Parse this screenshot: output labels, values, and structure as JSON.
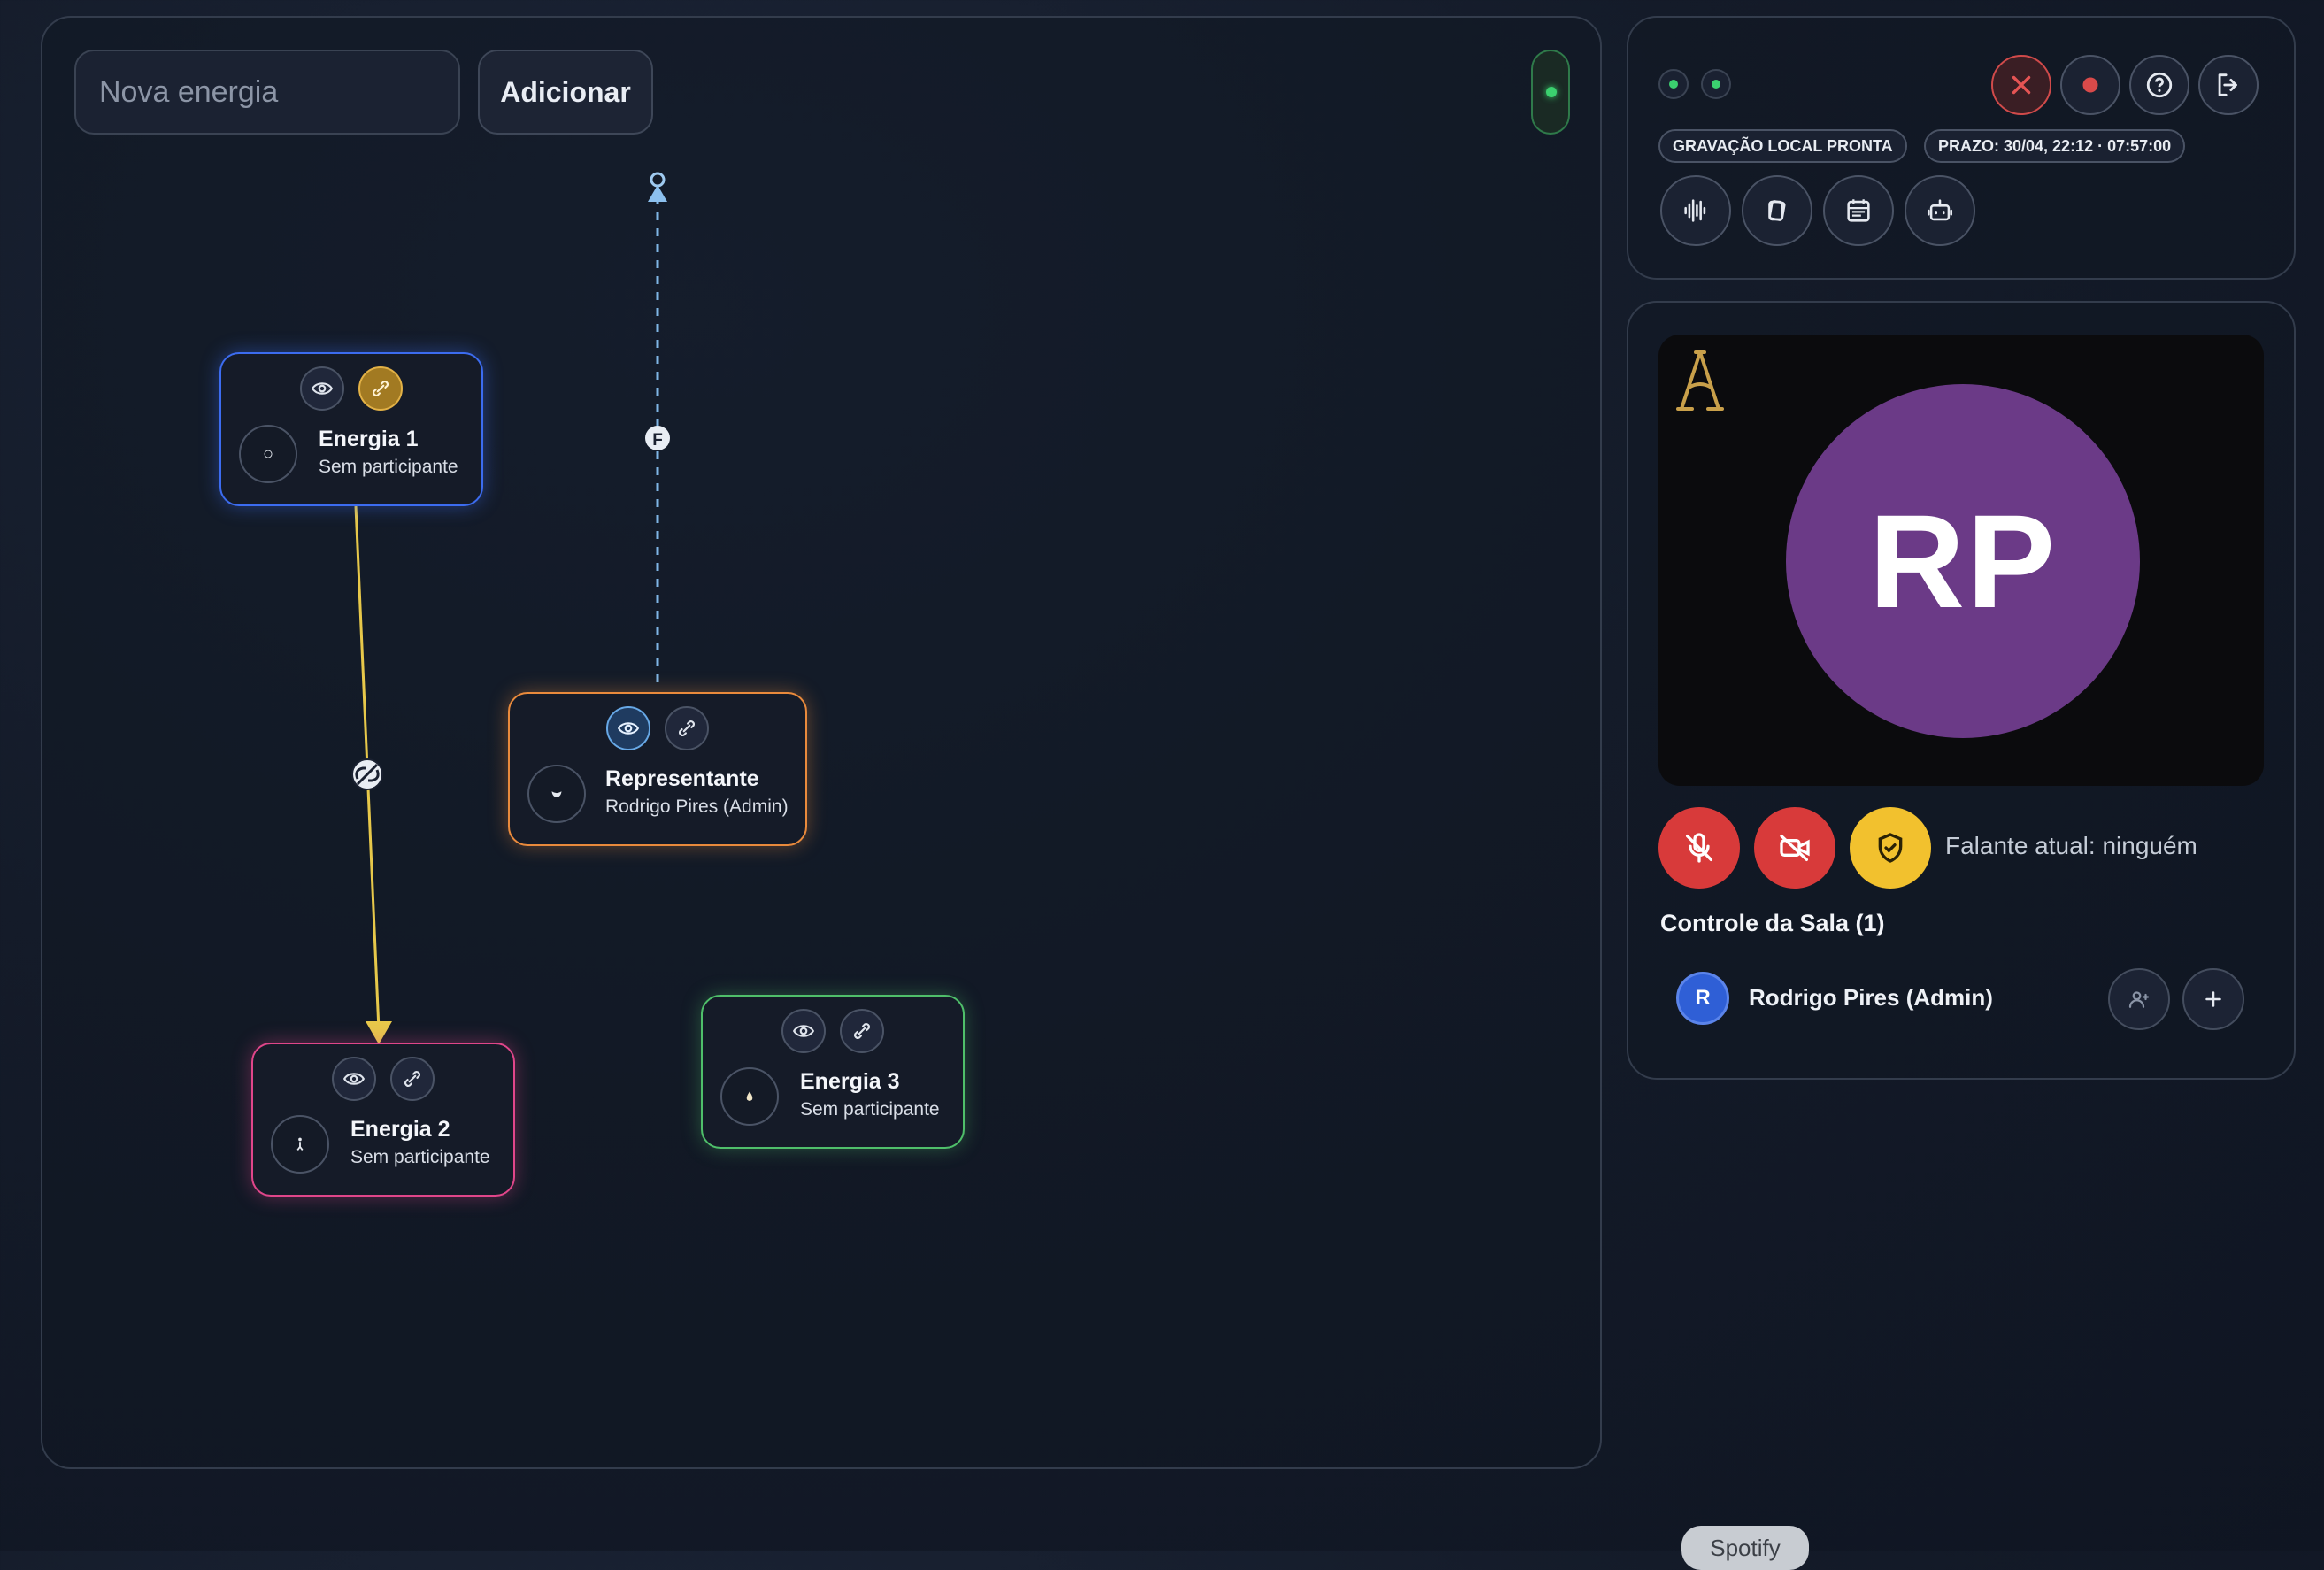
{
  "toolbar": {
    "input_value": "",
    "input_placeholder": "Nova energia",
    "add_label": "Adicionar"
  },
  "nodes": {
    "energia1": {
      "title": "Energia 1",
      "subtitle": "Sem participante",
      "icon": "circle-icon",
      "color": "#3c6cf0"
    },
    "representante": {
      "title": "Representante",
      "subtitle": "Rodrigo Pires (Admin)",
      "icon": "mask-icon",
      "color": "#e98a3c"
    },
    "energia2": {
      "title": "Energia 2",
      "subtitle": "Sem participante",
      "icon": "figure-icon",
      "color": "#e0468a"
    },
    "energia3": {
      "title": "Energia 3",
      "subtitle": "Sem participante",
      "icon": "drop-icon",
      "color": "#4fbf6a"
    }
  },
  "edges": {
    "flow_marker": "F",
    "link_color": "#e7c84a",
    "dashed_color": "#7fb6e6"
  },
  "status": {
    "recording_badge": "GRAVAÇÃO LOCAL PRONTA",
    "deadline_badge": "PRAZO: 30/04, 22:12 · 07:57:00"
  },
  "call": {
    "avatar_initials": "RP",
    "avatar_color": "#6b3a87",
    "speaker_text": "Falante atual: ninguém",
    "room_title": "Controle da Sala (1)",
    "participant": {
      "initial": "R",
      "name": "Rodrigo Pires (Admin)"
    }
  },
  "footer": {
    "spotify_label": "Spotify"
  }
}
